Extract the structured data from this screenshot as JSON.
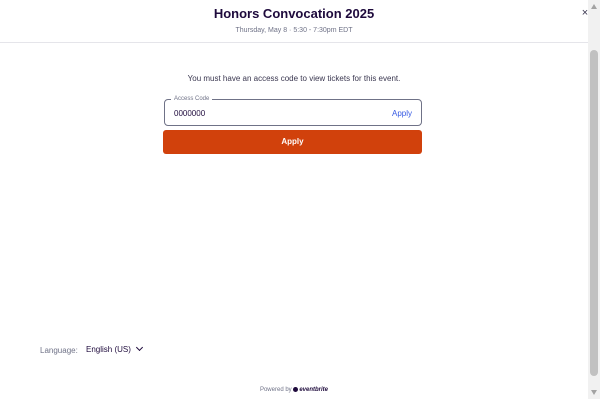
{
  "header": {
    "title": "Honors Convocation 2025",
    "subtitle": "Thursday, May 8 · 5:30 - 7:30pm EDT",
    "close_label": "×"
  },
  "main": {
    "message": "You must have an access code to view tickets for this event.",
    "access_code": {
      "label": "Access Code",
      "value": "0000000",
      "inline_apply_label": "Apply"
    },
    "apply_button_label": "Apply"
  },
  "footer": {
    "language_label": "Language:",
    "language_value": "English (US)",
    "powered_by": "Powered by",
    "brand": "eventbrite"
  },
  "colors": {
    "accent": "#d1410c",
    "link": "#3659e3",
    "text": "#1e0a3c"
  },
  "icons": {
    "close": "close-icon",
    "language_dropdown": "chevron-down-icon",
    "brand": "eventbrite-logo"
  }
}
